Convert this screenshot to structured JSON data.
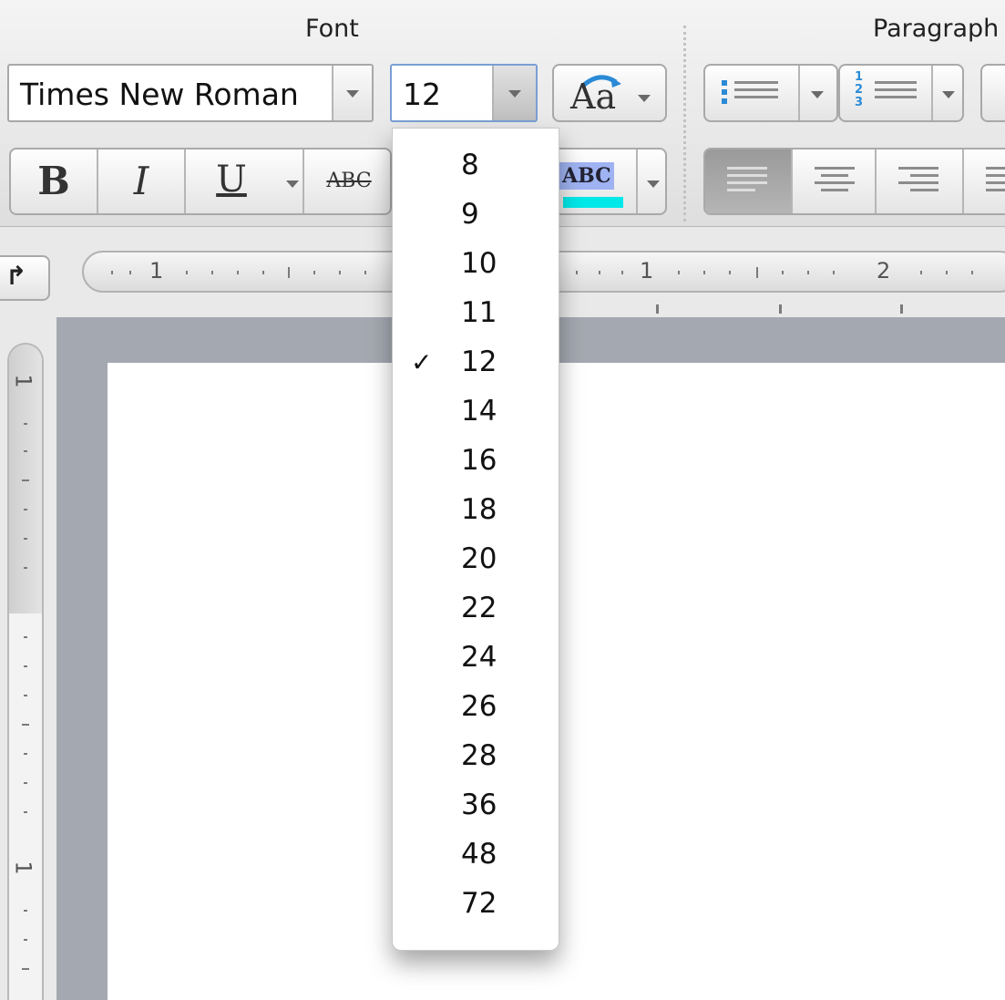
{
  "ribbon": {
    "font_group_title": "Font",
    "paragraph_group_title": "Paragraph",
    "font_name": "Times New Roman",
    "font_size": "12",
    "change_case_label": "Aa",
    "bold_label": "B",
    "italic_label": "I",
    "underline_label": "U",
    "strikethrough_label": "ABC",
    "highlight_label": "ABC",
    "highlight_color": "#00e8e8"
  },
  "rulers": {
    "horizontal_labels": [
      "1",
      "1",
      "2"
    ],
    "vertical_labels": [
      "1",
      "1"
    ]
  },
  "font_size_menu": {
    "selected": "12",
    "check_mark": "✓",
    "options": [
      "8",
      "9",
      "10",
      "11",
      "12",
      "14",
      "16",
      "18",
      "20",
      "22",
      "24",
      "26",
      "28",
      "36",
      "48",
      "72"
    ]
  }
}
